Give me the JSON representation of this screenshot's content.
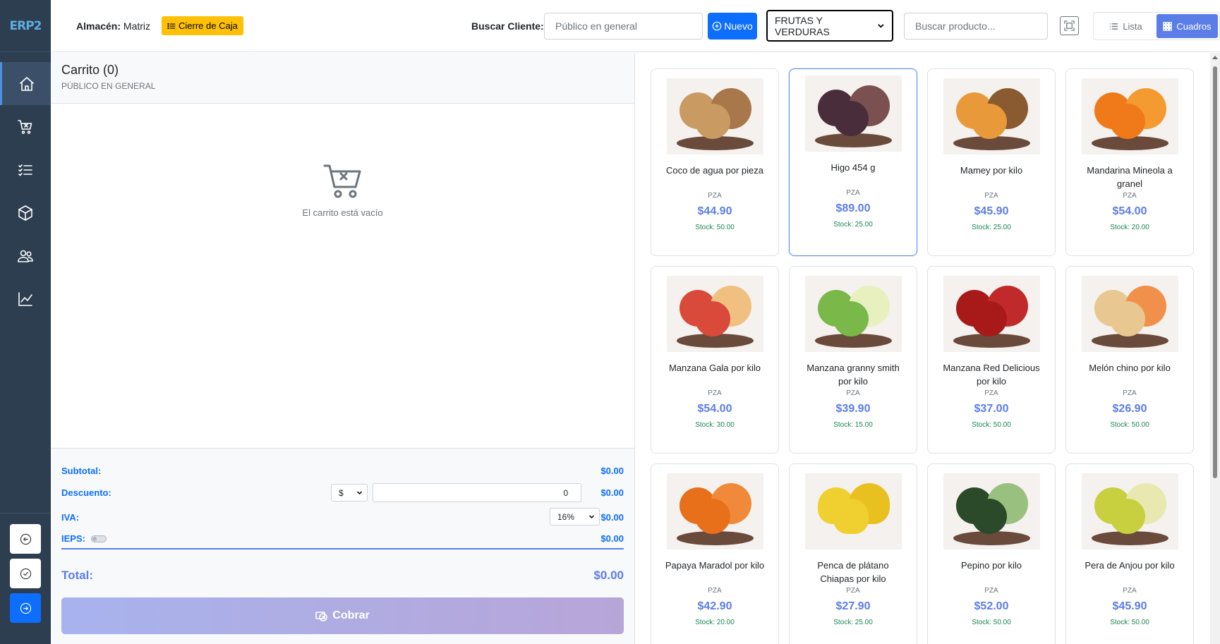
{
  "app": {
    "logo": "ERP2"
  },
  "sidebar": {
    "items": [
      {
        "icon": "home-icon",
        "active": true
      },
      {
        "icon": "cart-icon"
      },
      {
        "icon": "list-check-icon"
      },
      {
        "icon": "box-icon"
      },
      {
        "icon": "users-icon"
      },
      {
        "icon": "chart-line-icon"
      }
    ],
    "bottom": [
      {
        "icon": "arrow-left-circle-icon"
      },
      {
        "icon": "check-circle-icon"
      },
      {
        "icon": "arrow-right-circle-icon"
      }
    ]
  },
  "header": {
    "almacen_label": "Almacén:",
    "almacen_value": "Matriz",
    "cierre_label": "Cierre de Caja",
    "buscar_cliente_label": "Buscar Cliente:",
    "cliente_placeholder": "Público en general",
    "nuevo_label": "Nuevo",
    "category_selected": "FRUTAS Y VERDURAS",
    "producto_placeholder": "Buscar producto...",
    "view_lista": "Lista",
    "view_cuadros": "Cuadros",
    "view_active": "Cuadros"
  },
  "cart": {
    "title": "Carrito (0)",
    "client": "PÚBLICO EN GENERAL",
    "empty_text": "El carrito está vacío",
    "subtotal_label": "Subtotal:",
    "subtotal_value": "$0.00",
    "descuento_label": "Descuento:",
    "descuento_type": "$",
    "descuento_input": "0",
    "descuento_value": "$0.00",
    "iva_label": "IVA:",
    "iva_rate": "16%",
    "iva_value": "$0.00",
    "ieps_label": "IEPS:",
    "ieps_enabled": false,
    "ieps_value": "$0.00",
    "total_label": "Total:",
    "total_value": "$0.00",
    "cobrar_label": "Cobrar"
  },
  "products": [
    {
      "name": "Coco de agua por pieza",
      "unit": "PZA",
      "price": "$44.90",
      "stock": "Stock: 50.00",
      "colors": [
        "#c99a62",
        "#a8774a"
      ]
    },
    {
      "name": "Higo 454 g",
      "unit": "PZA",
      "price": "$89.00",
      "stock": "Stock: 25.00",
      "colors": [
        "#4a2d3a",
        "#7a5050"
      ],
      "selected": true
    },
    {
      "name": "Mamey por kilo",
      "unit": "PZA",
      "price": "$45.90",
      "stock": "Stock: 25.00",
      "colors": [
        "#e89a3a",
        "#8a5a30"
      ]
    },
    {
      "name": "Mandarina Mineola a granel",
      "unit": "PZA",
      "price": "$54.00",
      "stock": "Stock: 20.00",
      "colors": [
        "#f07a1a",
        "#f59a30"
      ]
    },
    {
      "name": "Manzana Gala por kilo",
      "unit": "PZA",
      "price": "$54.00",
      "stock": "Stock: 30.00",
      "colors": [
        "#d94a3a",
        "#f0c080"
      ]
    },
    {
      "name": "Manzana granny smith por kilo",
      "unit": "PZA",
      "price": "$39.90",
      "stock": "Stock: 15.00",
      "colors": [
        "#7ab84a",
        "#e8f0c0"
      ]
    },
    {
      "name": "Manzana Red Delicious por kilo",
      "unit": "PZA",
      "price": "$37.00",
      "stock": "Stock: 50.00",
      "colors": [
        "#a81a1a",
        "#c02a2a"
      ]
    },
    {
      "name": "Melón chino por kilo",
      "unit": "PZA",
      "price": "$26.90",
      "stock": "Stock: 50.00",
      "colors": [
        "#e8c890",
        "#f0904a"
      ]
    },
    {
      "name": "Papaya Maradol por kilo",
      "unit": "PZA",
      "price": "$42.90",
      "stock": "Stock: 20.00",
      "colors": [
        "#e8701a",
        "#f08a3a"
      ]
    },
    {
      "name": "Penca de plátano Chiapas por kilo",
      "unit": "PZA",
      "price": "$27.90",
      "stock": "Stock: 25.00",
      "colors": [
        "#f0d030",
        "#e8c020"
      ],
      "no_plate": true
    },
    {
      "name": "Pepino por kilo",
      "unit": "PZA",
      "price": "$52.00",
      "stock": "Stock: 50.00",
      "colors": [
        "#2a4a2a",
        "#9ac080"
      ]
    },
    {
      "name": "Pera de Anjou por kilo",
      "unit": "PZA",
      "price": "$45.90",
      "stock": "Stock: 50.00",
      "colors": [
        "#c8d040",
        "#e8e8b0"
      ]
    }
  ]
}
